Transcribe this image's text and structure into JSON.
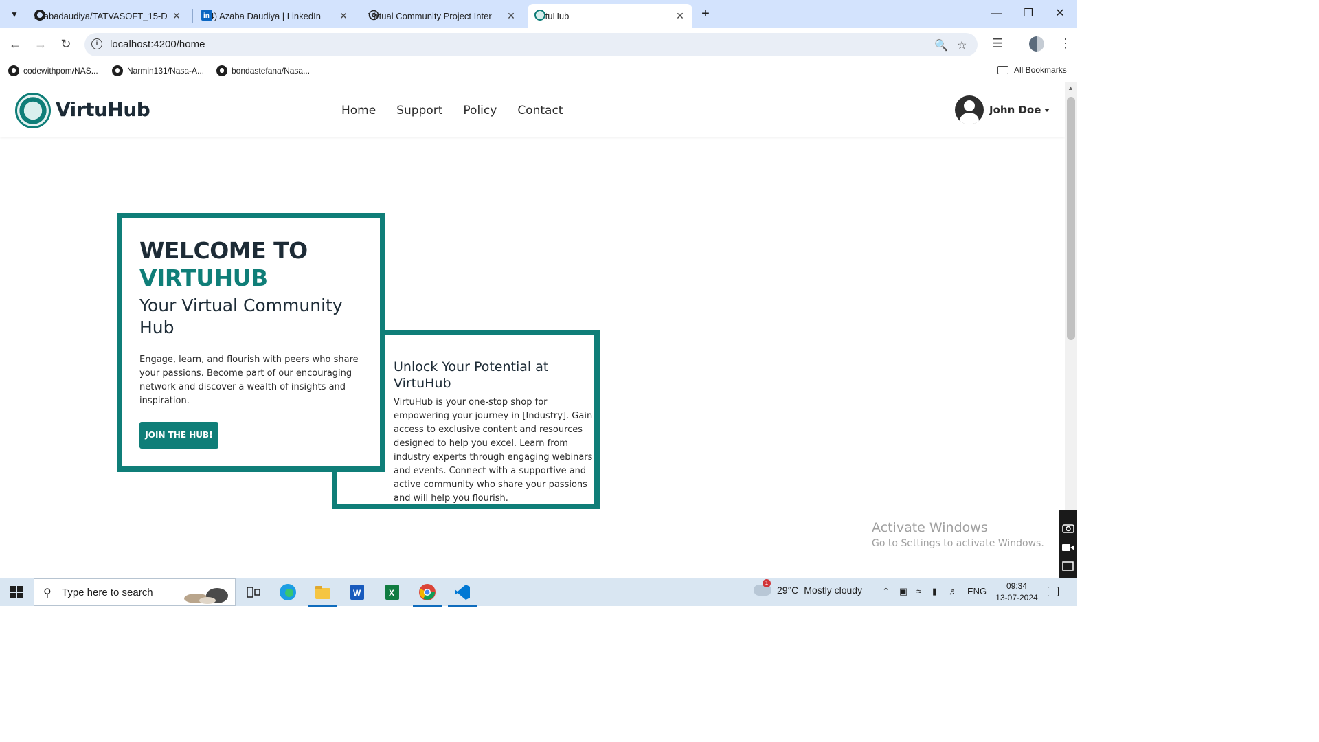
{
  "browser": {
    "tabs": [
      {
        "label": "azabadaudiya/TATVASOFT_15-D",
        "icon": "github-icon"
      },
      {
        "label": "(14) Azaba Daudiya | LinkedIn",
        "icon": "linkedin-icon"
      },
      {
        "label": "Virtual Community Project Inter",
        "icon": "openai-icon"
      },
      {
        "label": "VirtuHub",
        "icon": "virtuhub-icon",
        "active": true
      }
    ],
    "url": "localhost:4200/home",
    "bookmarks": [
      {
        "label": "codewithpom/NAS..."
      },
      {
        "label": "Narmin131/Nasa-A..."
      },
      {
        "label": "bondastefana/Nasa..."
      }
    ],
    "all_bookmarks": "All Bookmarks"
  },
  "site": {
    "brand": "VirtuHub",
    "nav": [
      "Home",
      "Support",
      "Policy",
      "Contact"
    ],
    "user_name": "John Doe",
    "accent_color": "#0f7e78"
  },
  "hero": {
    "welcome": "WELCOME TO",
    "brand_upper": "VIRTUHUB",
    "subtitle": "Your Virtual Community Hub",
    "body": "Engage, learn, and flourish with peers who share your passions. Become part of our encouraging network and discover a wealth of insights and inspiration.",
    "cta": "JOIN THE HUB!"
  },
  "info": {
    "title": "Unlock Your Potential at VirtuHub",
    "body": "VirtuHub is your one-stop shop for empowering your journey in [Industry]. Gain access to exclusive content and resources designed to help you excel. Learn from industry experts through engaging webinars and events. Connect with a supportive and active community who share your passions and will help you flourish."
  },
  "watermark": {
    "line1": "Activate Windows",
    "line2": "Go to Settings to activate Windows."
  },
  "taskbar": {
    "search_placeholder": "Type here to search",
    "weather_temp": "29°C",
    "weather_desc": "Mostly cloudy",
    "weather_badge": "1",
    "lang": "ENG",
    "time": "09:34",
    "date": "13-07-2024"
  }
}
